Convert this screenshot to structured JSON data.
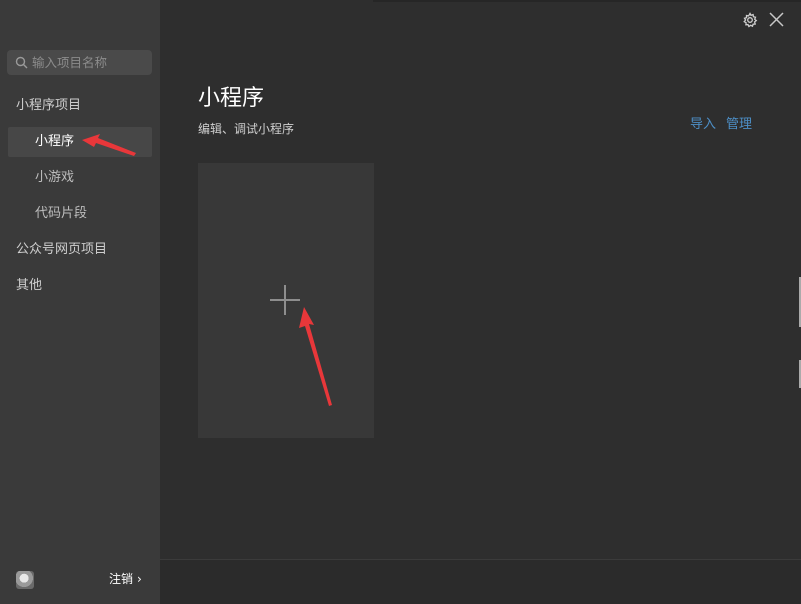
{
  "sidebar": {
    "search_placeholder": "输入项目名称",
    "groups": [
      {
        "label": "小程序项目"
      },
      {
        "label": "公众号网页项目"
      },
      {
        "label": "其他"
      }
    ],
    "sub_items": [
      {
        "label": "小程序",
        "active": true
      },
      {
        "label": "小游戏",
        "active": false
      },
      {
        "label": "代码片段",
        "active": false
      }
    ],
    "footer": {
      "logout_label": "注销",
      "chevron": "›"
    }
  },
  "main": {
    "title": "小程序",
    "subtitle": "编辑、调试小程序",
    "import_label": "导入",
    "manage_label": "管理",
    "add_icon": "plus-icon"
  },
  "window": {
    "icons": [
      "gear-icon",
      "close-icon"
    ]
  },
  "colors": {
    "sidebar_bg": "#3a3a3a",
    "main_bg": "#2e2e2e",
    "link": "#4d8fc7",
    "annotation_arrow": "#e8373a"
  }
}
